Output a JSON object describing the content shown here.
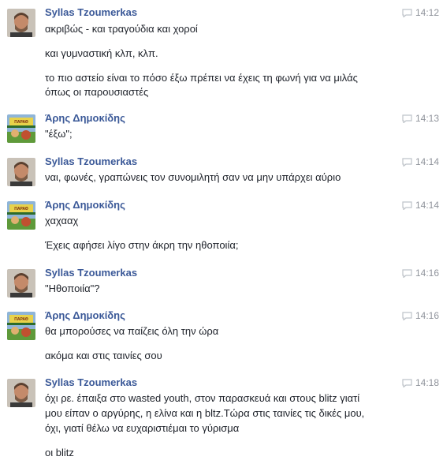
{
  "messages": [
    {
      "sender": "Syllas Tzoumerkas",
      "time": "14:12",
      "avatar": "man-avatar",
      "lines": [
        "ακριβώς - και τραγούδια και χοροί",
        "και γυμναστική κλπ, κλπ.",
        "το πιο αστείο είναι το πόσο έξω πρέπει να έχεις τη φωνή για να μιλάς",
        "όπως οι παρουσιαστές"
      ]
    },
    {
      "sender": "Άρης Δημοκίδης",
      "time": "14:13",
      "avatar": "comic-avatar",
      "lines": [
        "\"έξω\";"
      ]
    },
    {
      "sender": "Syllas Tzoumerkas",
      "time": "14:14",
      "avatar": "man-avatar",
      "lines": [
        "ναι, φωνές, γραπώνεις τον συνομιλητή σαν να μην υπάρχει αύριο"
      ]
    },
    {
      "sender": "Άρης Δημοκίδης",
      "time": "14:14",
      "avatar": "comic-avatar",
      "lines": [
        "χαχααχ",
        "Έχεις αφήσει λίγο στην άκρη την ηθοποιία;"
      ]
    },
    {
      "sender": "Syllas Tzoumerkas",
      "time": "14:16",
      "avatar": "man-avatar",
      "lines": [
        "\"Ηθοποιία\"?"
      ]
    },
    {
      "sender": "Άρης Δημοκίδης",
      "time": "14:16",
      "avatar": "comic-avatar",
      "lines": [
        "θα μπορούσες να παίζεις όλη την ώρα",
        "ακόμα και στις ταινίες σου"
      ]
    },
    {
      "sender": "Syllas Tzoumerkas",
      "time": "14:18",
      "avatar": "man-avatar",
      "lines": [
        "όχι ρε. έπαιξα στο wasted youth,  στον παρασκευά και στους blitz γιατί",
        "μου είπαν ο αργύρης, η ελίνα και η bltz.Τώρα στις ταινίες τις δικές μου,",
        "όχι, γιατί θέλω να ευχαριστιέμαι το γύρισμα",
        "οι blitz"
      ]
    }
  ],
  "colors": {
    "sender": "#3b5998",
    "time": "#90949c",
    "text": "#1d2129"
  }
}
